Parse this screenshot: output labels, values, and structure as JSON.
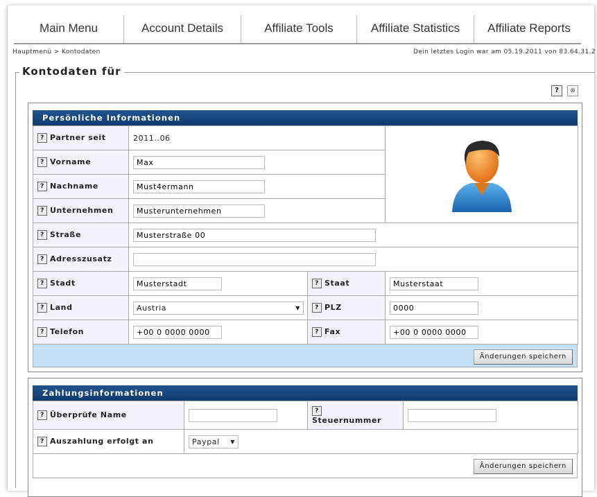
{
  "nav": {
    "tabs": [
      "Main Menu",
      "Account Details",
      "Affiliate Tools",
      "Affiliate Statistics",
      "Affiliate Reports"
    ]
  },
  "breadcrumb": {
    "home": "Hauptmenü",
    "separator": " > ",
    "current": "Kontodaten"
  },
  "last_login": "Dein letztes Login war am 05.19.2011 von 83.64.31.2",
  "legend": "Kontodaten für",
  "help_glyph": "?",
  "personal": {
    "title": "Persönliche Informationen",
    "partner_since_label": "Partner seit",
    "partner_since_value": "2011..06",
    "first_name_label": "Vorname",
    "first_name_value": "Max",
    "last_name_label": "Nachname",
    "last_name_value": "Must4ermann",
    "company_label": "Unternehmen",
    "company_value": "Musterunternehmen",
    "street_label": "Straße",
    "street_value": "Musterstraße 00",
    "address2_label": "Adresszusatz",
    "address2_value": "",
    "city_label": "Stadt",
    "city_value": "Musterstadt",
    "state_label": "Staat",
    "state_value": "Musterstaat",
    "country_label": "Land",
    "country_value": "Austria",
    "zip_label": "PLZ",
    "zip_value": "0000",
    "phone_label": "Telefon",
    "phone_value": "+00 0 0000 0000",
    "fax_label": "Fax",
    "fax_value": "+00 0 0000 0000",
    "save_label": "Änderungen speichern"
  },
  "payment": {
    "title": "Zahlungsinformationen",
    "check_name_label": "Überprüfe Name",
    "check_name_value": "",
    "tax_label": "Steuernummer",
    "tax_value": "",
    "payout_label": "Auszahlung erfolgt an",
    "payout_value": "Paypal",
    "save_label": "Änderungen speichern"
  },
  "colors": {
    "header_blue": "#0d3a6e",
    "save_bar": "#c5e0f7",
    "label_bg": "#f3f3fb",
    "avatar_head": "#f08a1c",
    "avatar_shirt": "#2a86d0"
  },
  "icons": {
    "help": "question-icon",
    "close": "close-icon",
    "avatar": "user-avatar-icon",
    "dropdown": "chevron-down-icon"
  }
}
